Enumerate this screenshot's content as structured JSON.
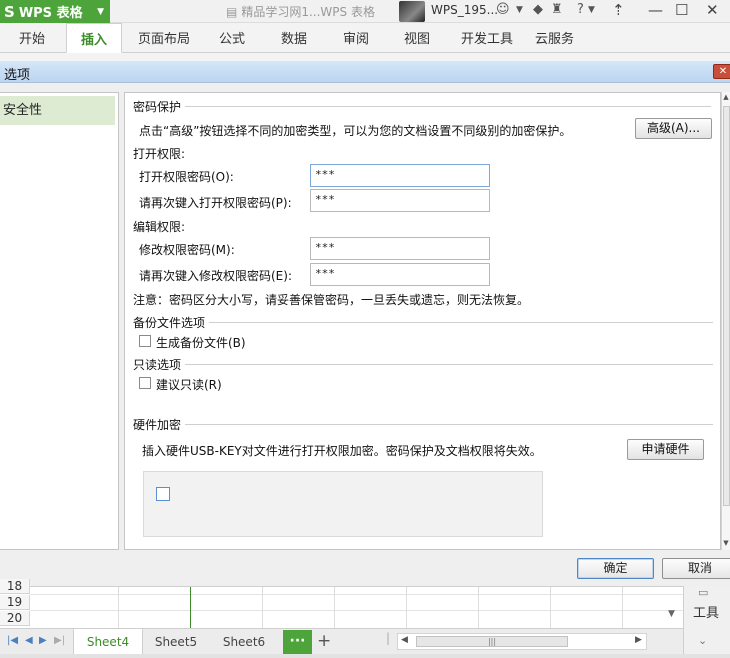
{
  "app": {
    "name": "WPS 表格",
    "doc_tab": "精品学习网1...WPS 表格",
    "user": "WPS_195...",
    "help": "?"
  },
  "ribbon": {
    "tabs": [
      "开始",
      "插入",
      "页面布局",
      "公式",
      "数据",
      "审阅",
      "视图",
      "开发工具",
      "云服务"
    ],
    "active": "插入"
  },
  "dialog": {
    "title": "选项",
    "nav": [
      "安全性"
    ],
    "password_section": "密码保护",
    "intro": "点击“高级”按钮选择不同的加密类型，可以为您的文档设置不同级别的加密保护。",
    "advanced_btn": "高级(A)...",
    "open_perm": "打开权限:",
    "open_pwd_label": "打开权限密码(O):",
    "open_pwd_value": "***",
    "open_pwd_confirm_label": "请再次键入打开权限密码(P):",
    "open_pwd_confirm_value": "***",
    "edit_perm": "编辑权限:",
    "edit_pwd_label": "修改权限密码(M):",
    "edit_pwd_value": "***",
    "edit_pwd_confirm_label": "请再次键入修改权限密码(E):",
    "edit_pwd_confirm_value": "***",
    "note": "注意：密码区分大小写，请妥善保管密码，一旦丢失或遗忘，则无法恢复。",
    "backup_section": "备份文件选项",
    "backup_checkbox": "生成备份文件(B)",
    "readonly_section": "只读选项",
    "readonly_checkbox": "建议只读(R)",
    "hardware_section": "硬件加密",
    "hardware_text": "插入硬件USB-KEY对文件进行打开权限加密。密码保护及文档权限将失效。",
    "hardware_btn": "申请硬件",
    "ok_btn": "确定",
    "cancel_btn": "取消"
  },
  "sheet": {
    "rows": [
      "18",
      "19",
      "20"
    ],
    "tabs": [
      "Sheet4",
      "Sheet5",
      "Sheet6"
    ],
    "active_tab": "Sheet4",
    "more": "···",
    "add": "+"
  },
  "side_panel": {
    "label": "工具"
  },
  "colors": {
    "brand": "#4da43a",
    "active_tab": "#3d8c2c",
    "nav_selected": "#dcebd1"
  }
}
